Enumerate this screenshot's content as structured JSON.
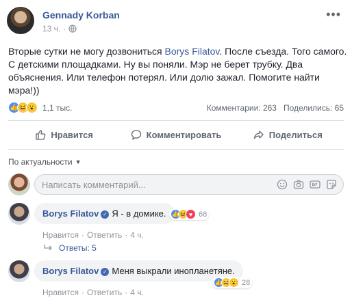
{
  "post": {
    "author": "Gennady Korban",
    "time": "13 ч.",
    "text_before": "Вторые сутки не могу дозвониться ",
    "mention": "Borys Filatov",
    "text_after": ". После съезда. Того самого. С детскими площадками. Ну вы поняли. Мэр не берет трубку. Два объяснения. Или телефон потерял. Или долю зажал. Помогите найти мэра!))",
    "reaction_count": "1,1 тыс.",
    "comments_stat": "Комментарии: 263",
    "shares_stat": "Поделились: 65",
    "reaction_icons": [
      "like-icon",
      "haha-icon",
      "wow-icon"
    ]
  },
  "actions": {
    "like": "Нравится",
    "comment": "Комментировать",
    "share": "Поделиться"
  },
  "sort": {
    "label": "По актуальности"
  },
  "composer": {
    "placeholder": "Написать комментарий..."
  },
  "comments": [
    {
      "author": "Borys Filatov",
      "text": "Я - в домике.",
      "reaction_count": "68",
      "reactions": [
        "like-icon",
        "haha-icon",
        "love-icon"
      ],
      "like": "Нравится",
      "reply": "Ответить",
      "time": "4 ч."
    },
    {
      "author": "Borys Filatov",
      "text": "Меня выкрали инопланетяне.",
      "reaction_count": "28",
      "reactions": [
        "like-icon",
        "haha-icon",
        "wow-icon"
      ],
      "like": "Нравится",
      "reply": "Ответить",
      "time": "4 ч."
    }
  ],
  "replies": {
    "label": "Ответы: 5"
  },
  "colors": {
    "link": "#385898",
    "meta": "#90949c",
    "bubble": "#f2f3f5",
    "like_blue": "#4a8cff"
  }
}
